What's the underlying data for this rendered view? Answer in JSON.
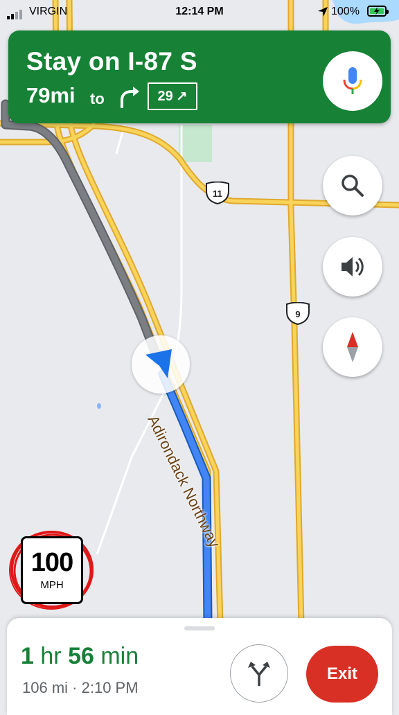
{
  "status_bar": {
    "carrier": "VIRGIN",
    "time": "12:14 PM",
    "battery": "100%",
    "icons": [
      "signal-icon",
      "location-arrow-icon",
      "battery-charging-icon"
    ]
  },
  "navigation": {
    "instruction": "Stay on I-87 S",
    "distance": "79mi",
    "distance_suffix": "to",
    "exit_number": "29",
    "exit_arrow": "↗",
    "turn_icon": "turn-right-icon",
    "voice_icon": "microphone-icon"
  },
  "map": {
    "route_shields": [
      "11",
      "9"
    ],
    "street_label": "Adirondack Northway",
    "controls": [
      "search-icon",
      "volume-icon",
      "compass-icon"
    ]
  },
  "speed_limit": {
    "value": "100",
    "unit": "MPH"
  },
  "trip": {
    "eta_hours": "1",
    "eta_hours_unit": "hr",
    "eta_minutes": "56",
    "eta_minutes_unit": "min",
    "distance": "106 mi",
    "separator": "·",
    "arrival": "2:10 PM",
    "alternates_icon": "route-split-icon",
    "exit_label": "Exit"
  },
  "colors": {
    "banner_green": "#178236",
    "eta_green": "#188038",
    "exit_red": "#d93025",
    "road_yellow": "#f6c544",
    "route_blue": "#1a73e8",
    "traveled_gray": "#6f7378"
  }
}
